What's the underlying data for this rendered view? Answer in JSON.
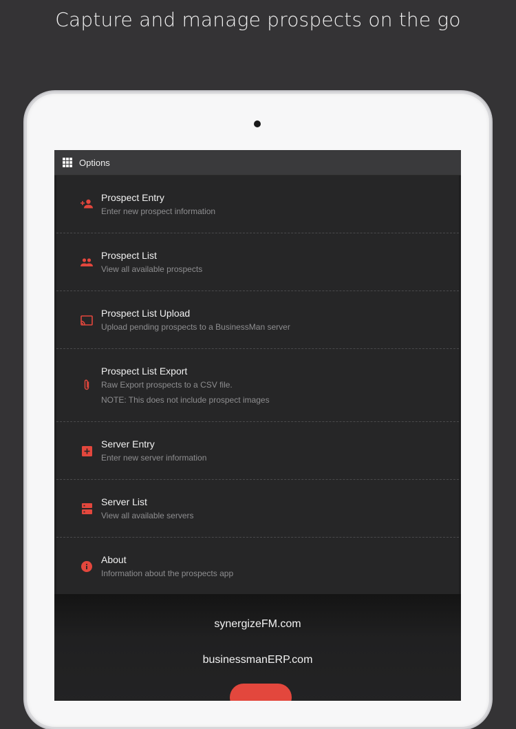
{
  "headline": "Capture and manage prospects on the go",
  "topbar": {
    "icon": "grid-icon",
    "title": "Options"
  },
  "menu": {
    "items": [
      {
        "icon": "person-add-icon",
        "title": "Prospect Entry",
        "subtitle": "Enter new prospect information"
      },
      {
        "icon": "people-icon",
        "title": "Prospect List",
        "subtitle": "View all available prospects"
      },
      {
        "icon": "cast-upload-icon",
        "title": "Prospect List Upload",
        "subtitle": "Upload pending prospects to a BusinessMan server"
      },
      {
        "icon": "paperclip-icon",
        "title": "Prospect List Export",
        "subtitle": "Raw Export prospects to a CSV file.",
        "note": "NOTE: This does not include prospect images"
      },
      {
        "icon": "add-box-icon",
        "title": "Server Entry",
        "subtitle": "Enter new server information"
      },
      {
        "icon": "server-icon",
        "title": "Server List",
        "subtitle": "View all available servers"
      },
      {
        "icon": "info-icon",
        "title": "About",
        "subtitle": "Information about the prospects app"
      }
    ]
  },
  "footer": {
    "link1": "synergizeFM.com",
    "link2": "businessmanERP.com"
  },
  "colors": {
    "background": "#343335",
    "accent": "#e3473d",
    "screen": "#262627",
    "topbar": "#3a3a3c"
  }
}
